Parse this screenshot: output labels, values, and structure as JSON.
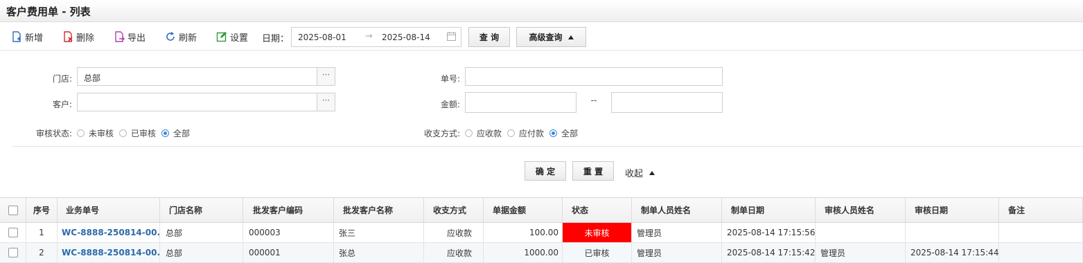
{
  "title": "客户费用单 - 列表",
  "toolbar": {
    "add": "新增",
    "delete": "删除",
    "export": "导出",
    "refresh": "刷新",
    "settings": "设置",
    "date_label": "日期：",
    "date_from": "2025-08-01",
    "date_arrow": "→",
    "date_to": "2025-08-14",
    "query": "查 询",
    "advanced_query": "高级查询"
  },
  "filters": {
    "store_label": "门店:",
    "store_value": "总部",
    "customer_label": "客户:",
    "customer_value": "",
    "more": "···",
    "doc_no_label": "单号:",
    "amount_label": "金额:",
    "amount_sep": "--",
    "audit_label": "审核状态:",
    "audit_options": [
      "未审核",
      "已审核",
      "全部"
    ],
    "audit_selected": "全部",
    "pay_label": "收支方式:",
    "pay_options": [
      "应收款",
      "应付款",
      "全部"
    ],
    "pay_selected": "全部",
    "confirm": "确 定",
    "reset": "重 置",
    "collapse": "收起"
  },
  "table": {
    "columns": [
      "序号",
      "业务单号",
      "门店名称",
      "批发客户编码",
      "批发客户名称",
      "收支方式",
      "单据金额",
      "状态",
      "制单人员姓名",
      "制单日期",
      "审核人员姓名",
      "审核日期",
      "备注"
    ],
    "rows": [
      [
        "1",
        "WC-8888-250814-00...",
        "总部",
        "000003",
        "张三",
        "应收款",
        "100.00",
        "未审核",
        "管理员",
        "2025-08-14 17:15:56",
        "",
        "",
        ""
      ],
      [
        "2",
        "WC-8888-250814-00...",
        "总部",
        "000001",
        "张总",
        "应收款",
        "1000.00",
        "已审核",
        "管理员",
        "2025-08-14 17:15:42",
        "管理员",
        "2025-08-14 17:15:44",
        ""
      ]
    ]
  },
  "colors": {
    "accent": "#3a86d8",
    "link": "#2a6aa8",
    "unaudited": "#ff0000"
  },
  "icons": {
    "add": "file-plus-icon",
    "delete": "file-delete-icon",
    "export": "file-export-icon",
    "refresh": "refresh-icon",
    "settings": "edit-settings-icon",
    "calendar": "calendar-icon"
  }
}
